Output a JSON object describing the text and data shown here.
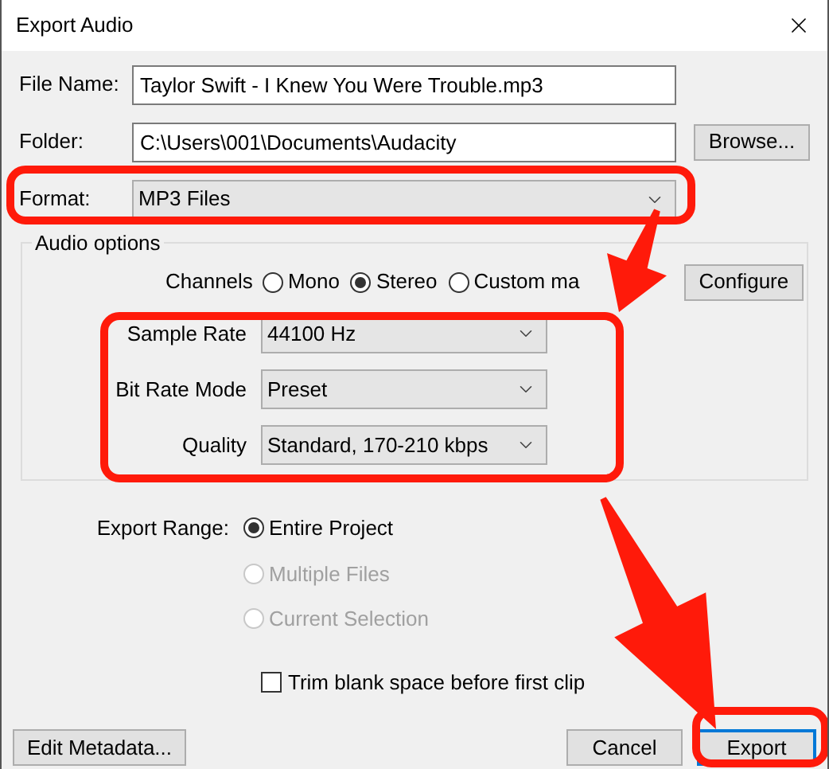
{
  "window": {
    "title": "Export Audio"
  },
  "file_name": {
    "label": "File Name:",
    "value": "Taylor Swift - I Knew You Were Trouble.mp3"
  },
  "folder": {
    "label": "Folder:",
    "value": "C:\\Users\\001\\Documents\\Audacity",
    "button": "Browse..."
  },
  "format": {
    "label": "Format:",
    "value": "MP3 Files"
  },
  "audio_options": {
    "title": "Audio options",
    "channels_label": "Channels",
    "channels": [
      {
        "label": "Mono",
        "selected": false
      },
      {
        "label": "Stereo",
        "selected": true
      },
      {
        "label": "Custom ma",
        "selected": false
      }
    ],
    "configure_button": "Configure",
    "settings": [
      {
        "label": "Sample Rate",
        "value": "44100 Hz"
      },
      {
        "label": "Bit Rate Mode",
        "value": "Preset"
      },
      {
        "label": "Quality",
        "value": "Standard, 170-210 kbps"
      }
    ]
  },
  "export_range": {
    "label": "Export Range:",
    "options": [
      {
        "label": "Entire Project",
        "selected": true,
        "disabled": false
      },
      {
        "label": "Multiple Files",
        "selected": false,
        "disabled": true
      },
      {
        "label": "Current Selection",
        "selected": false,
        "disabled": true
      }
    ]
  },
  "trim": {
    "label": "Trim blank space before first clip",
    "checked": false
  },
  "buttons": [
    {
      "label": "Edit Metadata...",
      "default": false
    },
    {
      "label": "Cancel",
      "default": false
    },
    {
      "label": "Export",
      "default": true
    }
  ]
}
